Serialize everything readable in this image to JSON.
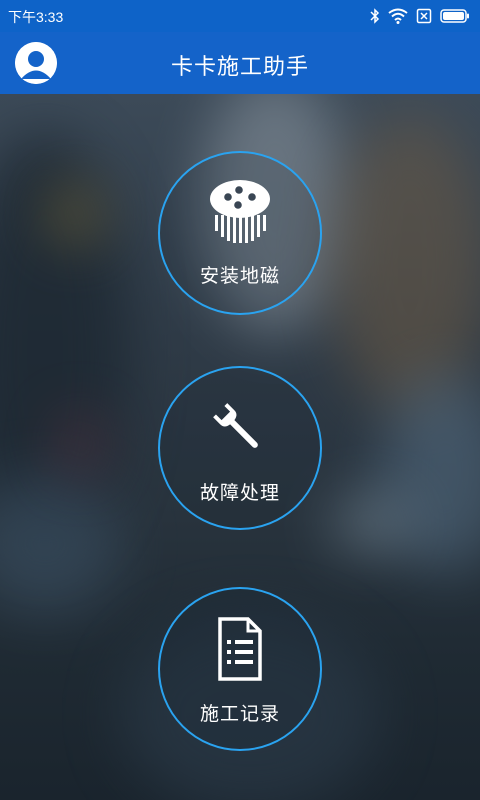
{
  "status_bar": {
    "time": "下午3:33"
  },
  "app_bar": {
    "title": "卡卡施工助手"
  },
  "actions": [
    {
      "label": "安装地磁"
    },
    {
      "label": "故障处理"
    },
    {
      "label": "施工记录"
    }
  ]
}
